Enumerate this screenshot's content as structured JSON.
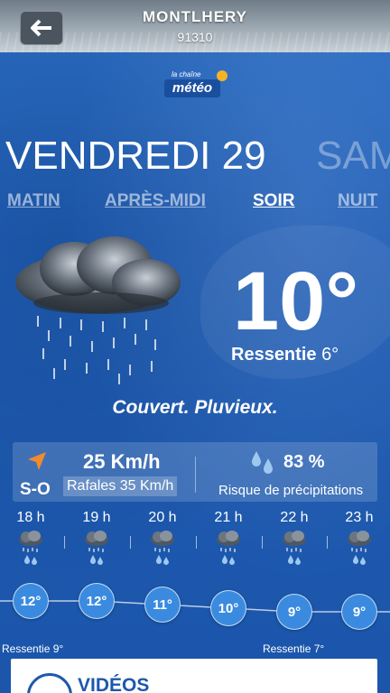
{
  "header": {
    "city": "MONTLHERY",
    "postcode": "91310"
  },
  "logo": {
    "small": "la chaîne",
    "main": "météo"
  },
  "day": {
    "current": "VENDREDI 29",
    "next": "SAM"
  },
  "periods": [
    {
      "label": "MATIN",
      "active": false
    },
    {
      "label": "APRÈS-MIDI",
      "active": false
    },
    {
      "label": "SOIR",
      "active": true
    },
    {
      "label": "NUIT",
      "active": false
    }
  ],
  "current": {
    "temperature": "10°",
    "feels_label": "Ressentie",
    "feels_value": "6°",
    "condition": "Couvert. Pluvieux.",
    "icon": "cloud-rain-icon"
  },
  "wind": {
    "direction": "S-O",
    "speed": "25 Km/h",
    "gusts": "Rafales 35 Km/h"
  },
  "precipitation": {
    "percent": "83 %",
    "label": "Risque de précipitations"
  },
  "hourly": [
    {
      "hour": "18 h",
      "temp": "12°",
      "value": 12
    },
    {
      "hour": "19 h",
      "temp": "12°",
      "value": 12
    },
    {
      "hour": "20 h",
      "temp": "11°",
      "value": 11
    },
    {
      "hour": "21 h",
      "temp": "10°",
      "value": 10
    },
    {
      "hour": "22 h",
      "temp": "9°",
      "value": 9
    },
    {
      "hour": "23 h",
      "temp": "9°",
      "value": 9
    }
  ],
  "hourly_feels": [
    "Ressentie 9°",
    "Ressentie 7°"
  ],
  "videos": {
    "title": "VIDÉOS"
  },
  "colors": {
    "background": "#1f5fb8",
    "bubble": "#3a8be0",
    "arrow": "#f08a2c",
    "drops": "#9ec8ef"
  }
}
